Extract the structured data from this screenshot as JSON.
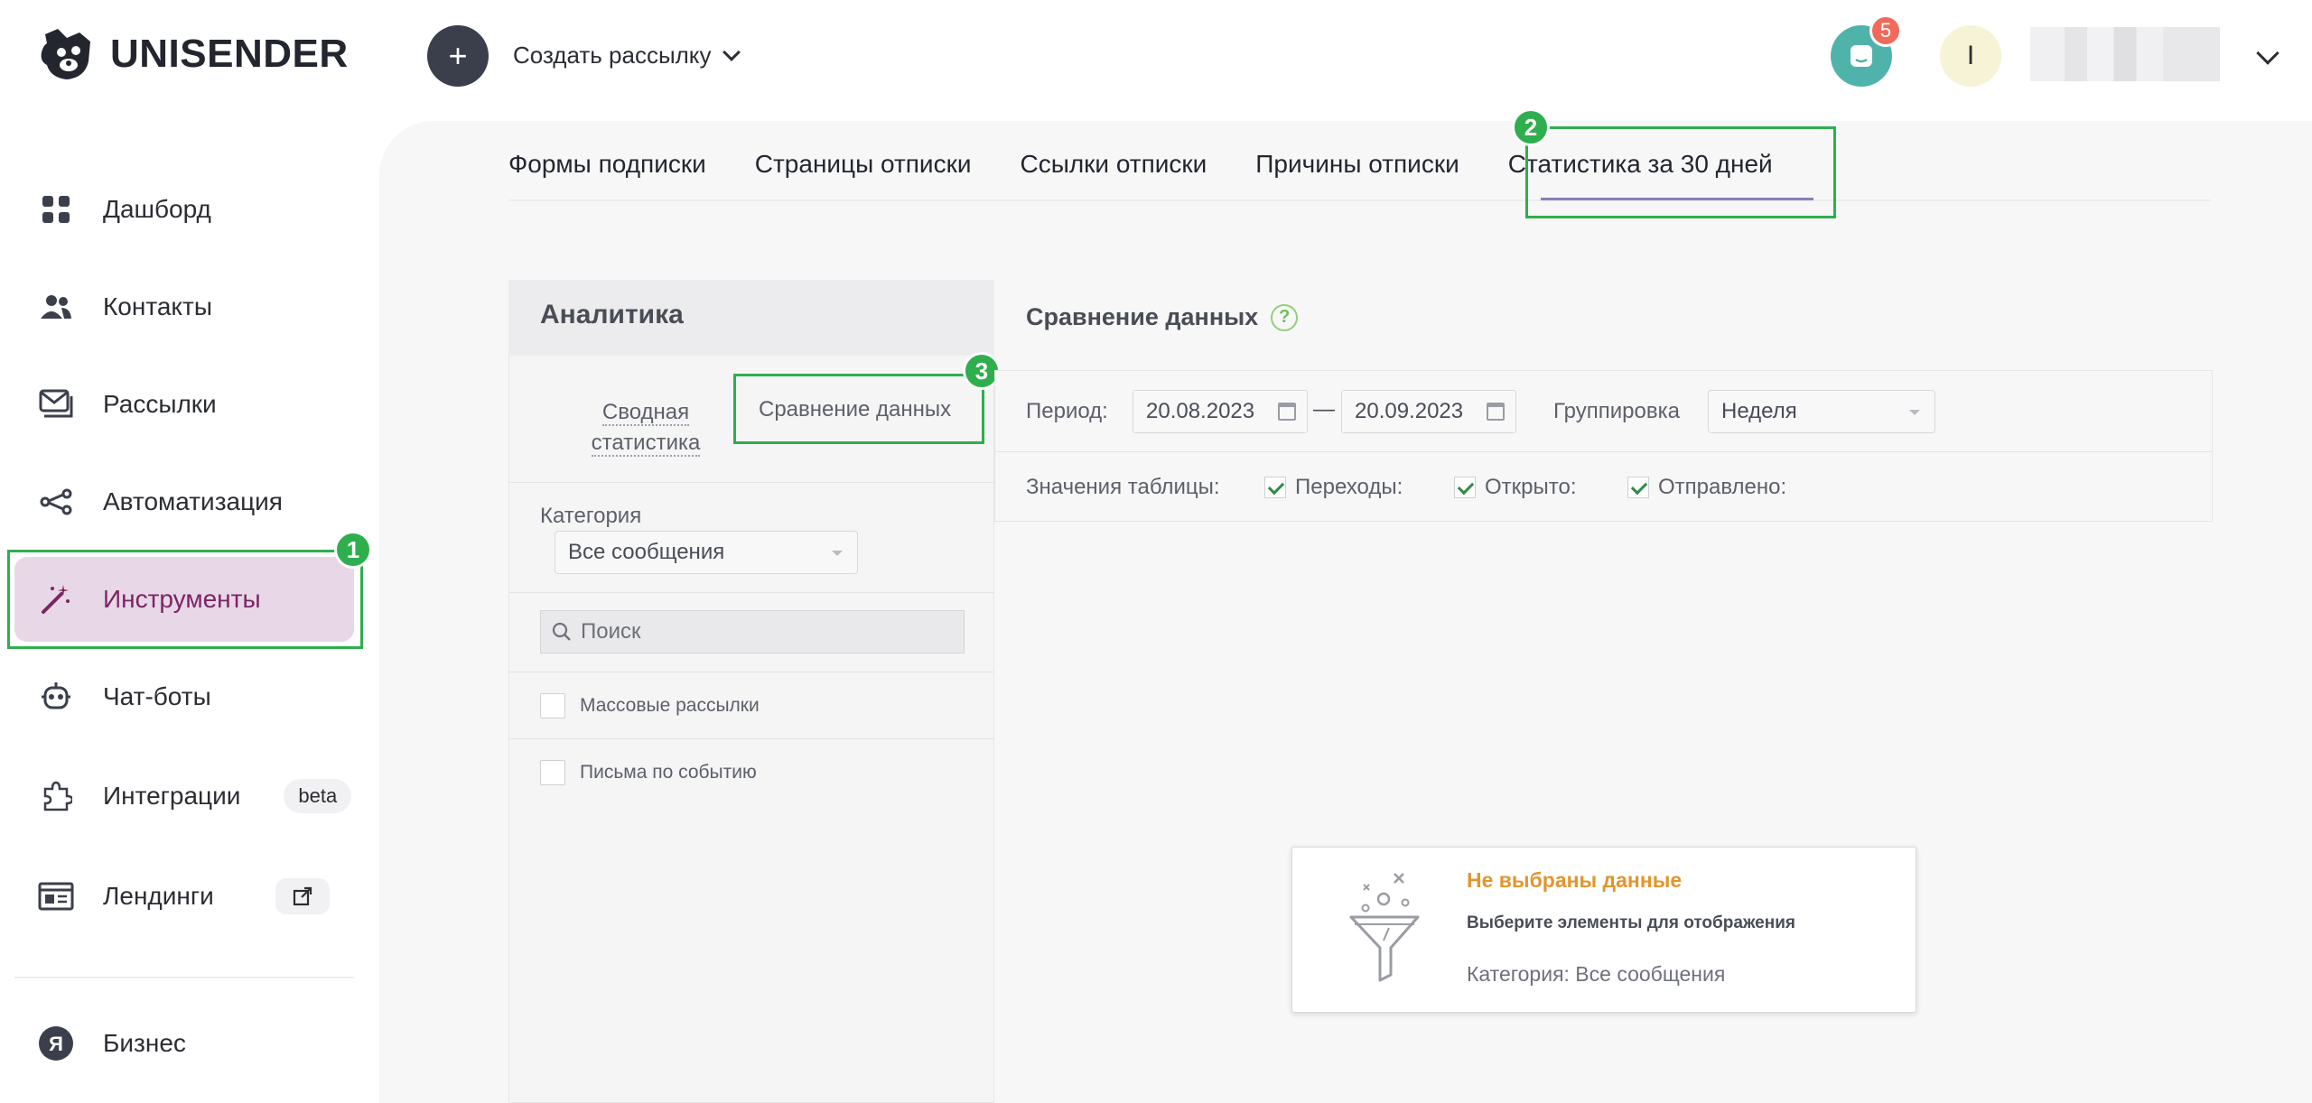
{
  "brand": {
    "name": "UNISENDER"
  },
  "header": {
    "create_label": "Создать рассылку",
    "chat_badge": "5",
    "avatar_letter": "I"
  },
  "sidebar": {
    "items": [
      {
        "label": "Дашборд",
        "icon": "dashboard-icon"
      },
      {
        "label": "Контакты",
        "icon": "contacts-icon"
      },
      {
        "label": "Рассылки",
        "icon": "mail-icon"
      },
      {
        "label": "Автоматизация",
        "icon": "automation-icon"
      },
      {
        "label": "Инструменты",
        "icon": "magic-wand-icon",
        "active": true
      },
      {
        "label": "Чат-боты",
        "icon": "robot-icon"
      },
      {
        "label": "Интеграции",
        "icon": "puzzle-icon",
        "badge": "beta"
      },
      {
        "label": "Лендинги",
        "icon": "landing-icon"
      },
      {
        "label": "Бизнес",
        "icon": "yandex-icon"
      }
    ]
  },
  "tabs": [
    "Формы подписки",
    "Страницы отписки",
    "Ссылки отписки",
    "Причины отписки",
    "Статистика за 30 дней"
  ],
  "annotations": {
    "one": "1",
    "two": "2",
    "three": "3"
  },
  "analytics": {
    "title": "Аналитика",
    "subtab_summary": "Сводная статистика",
    "subtab_compare": "Сравнение данных",
    "category_label": "Категория",
    "category_value": "Все сообщения",
    "search_placeholder": "Поиск",
    "list": [
      "Массовые рассылки",
      "Письма по событию"
    ]
  },
  "compare": {
    "title": "Сравнение данных",
    "period_label": "Период:",
    "date_from": "20.08.2023",
    "date_sep": "—",
    "date_to": "20.09.2023",
    "group_label": "Группировка",
    "group_value": "Неделя",
    "table_values_label": "Значения таблицы:",
    "checks": [
      "Переходы:",
      "Открыто:",
      "Отправлено:"
    ]
  },
  "empty_state": {
    "title": "Не выбраны данные",
    "subtitle": "Выберите элементы для отображения",
    "category": "Категория: Все сообщения"
  },
  "colors": {
    "accent": "#2fae4e",
    "active_bg": "#e8d7e6",
    "active_text": "#7a2565",
    "warning": "#e2952d"
  }
}
